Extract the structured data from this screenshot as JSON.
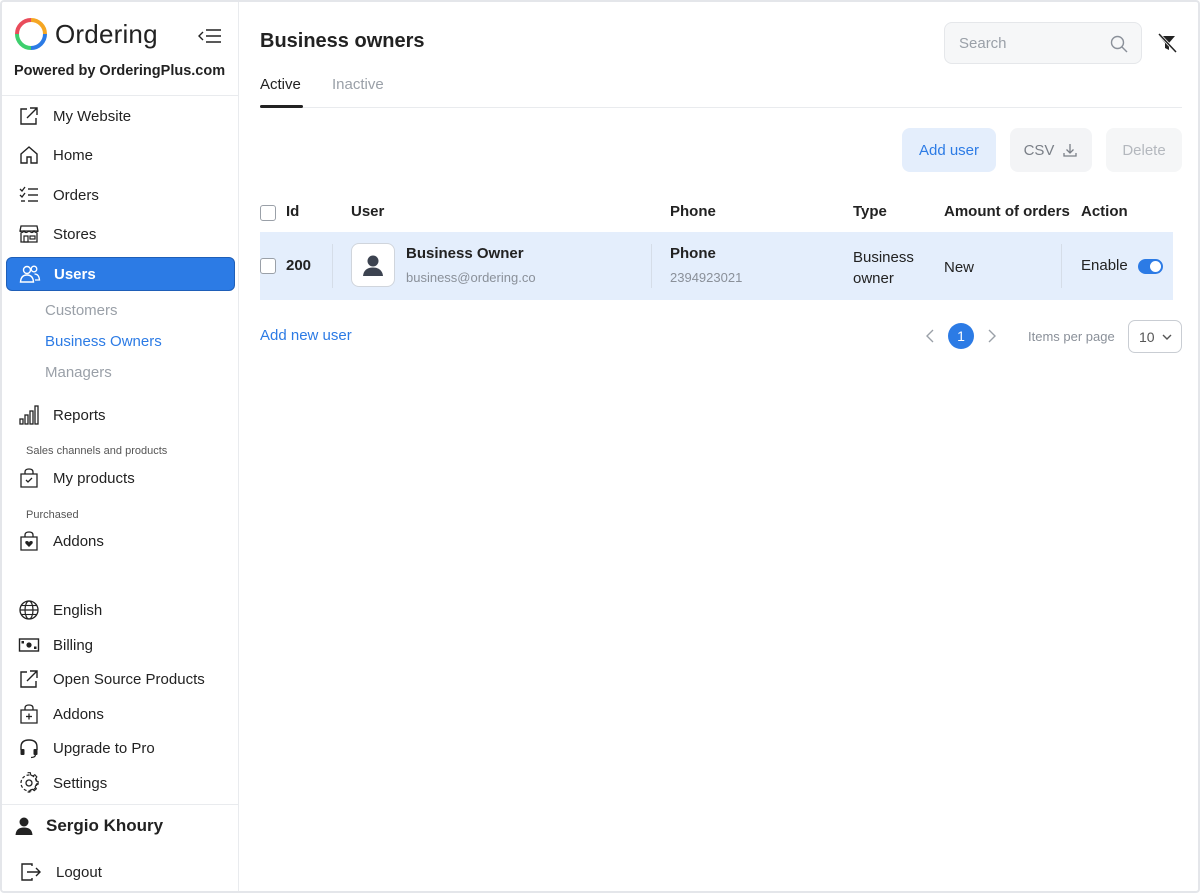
{
  "brand": {
    "name": "Ordering",
    "powered_by": "Powered by OrderingPlus.com"
  },
  "sidebar": {
    "items": [
      {
        "label": "My Website",
        "icon": "external-link-icon"
      },
      {
        "label": "Home",
        "icon": "home-icon"
      },
      {
        "label": "Orders",
        "icon": "list-check-icon"
      },
      {
        "label": "Stores",
        "icon": "shop-icon"
      },
      {
        "label": "Users",
        "icon": "users-icon",
        "active": true
      },
      {
        "label": "Reports",
        "icon": "bar-chart-icon"
      },
      {
        "label": "My products",
        "icon": "bag-check-icon"
      },
      {
        "label": "Addons",
        "icon": "bag-heart-icon"
      },
      {
        "label": "English",
        "icon": "globe-icon"
      },
      {
        "label": "Billing",
        "icon": "cash-icon"
      },
      {
        "label": "Open Source Products",
        "icon": "external-link-icon"
      },
      {
        "label": "Addons",
        "icon": "bag-plus-icon"
      },
      {
        "label": "Upgrade to Pro",
        "icon": "headset-icon"
      },
      {
        "label": "Settings",
        "icon": "gear-icon"
      }
    ],
    "users_sub": [
      "Customers",
      "Business Owners",
      "Managers"
    ],
    "section_sales": "Sales channels and products",
    "section_purchased": "Purchased",
    "user_name": "Sergio Khoury",
    "logout": "Logout"
  },
  "header": {
    "title": "Business owners",
    "search_placeholder": "Search",
    "tabs": [
      "Active",
      "Inactive"
    ]
  },
  "actions": {
    "add_user": "Add user",
    "csv": "CSV",
    "delete": "Delete"
  },
  "table": {
    "columns": [
      "Id",
      "User",
      "Phone",
      "Type",
      "Amount of orders",
      "Action"
    ],
    "rows": [
      {
        "id": "200",
        "name": "Business Owner",
        "email": "business@ordering.co",
        "phone_label": "Phone",
        "phone": "2394923021",
        "type_line1": "Business",
        "type_line2": "owner",
        "orders": "New",
        "action": "Enable",
        "enabled": true
      }
    ]
  },
  "footer": {
    "add_new_user": "Add new user",
    "current_page": "1",
    "items_per_page_label": "Items per page",
    "items_per_page": "10"
  },
  "colors": {
    "accent": "#2c7be5",
    "row_highlight": "#e4eefc"
  }
}
